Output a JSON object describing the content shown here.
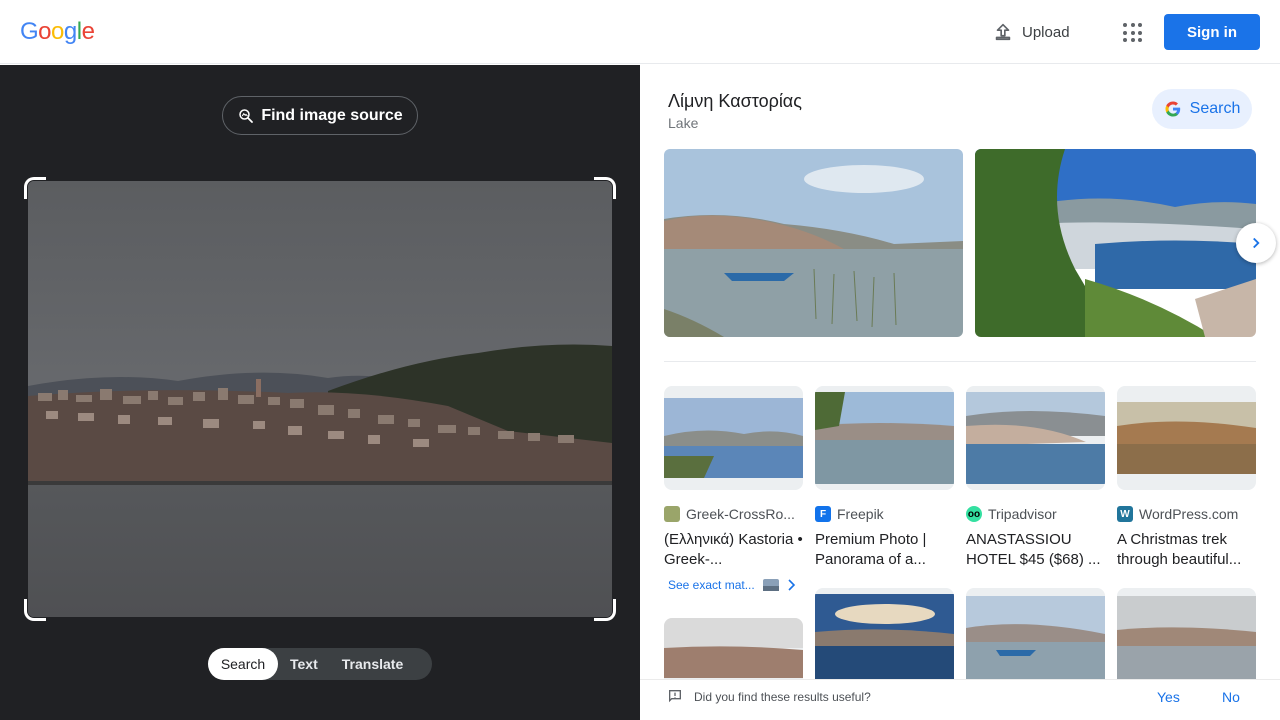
{
  "header": {
    "logo": [
      "G",
      "o",
      "o",
      "g",
      "l",
      "e"
    ],
    "logo_colors": [
      "#4285F4",
      "#EA4335",
      "#FBBC05",
      "#4285F4",
      "#34A853",
      "#EA4335"
    ],
    "upload_label": "Upload",
    "signin_label": "Sign in"
  },
  "left_panel": {
    "find_source_label": "Find image source",
    "modes": [
      "Search",
      "Text",
      "Translate"
    ],
    "active_mode": "Search"
  },
  "knowledge_panel": {
    "title": "Λίμνη Καστορίας",
    "subtitle": "Lake",
    "search_label": "Search"
  },
  "results": [
    {
      "source": "Greek-CrossRo...",
      "title": "(Ελληνικά) Kastoria • Greek-...",
      "fav_color": "#9aa56a"
    },
    {
      "source": "Freepik",
      "title": "Premium Photo | Panorama of a...",
      "fav_color": "#1273eb"
    },
    {
      "source": "Tripadvisor",
      "title": "ANASTASSIOU HOTEL $45 ($68) ...",
      "fav_color": "#34e0a1"
    },
    {
      "source": "WordPress.com",
      "title": "A Christmas trek through beautiful...",
      "fav_color": "#21759b"
    }
  ],
  "exact_match_label": "See exact mat...",
  "footer": {
    "question": "Did you find these results useful?",
    "yes": "Yes",
    "no": "No"
  }
}
